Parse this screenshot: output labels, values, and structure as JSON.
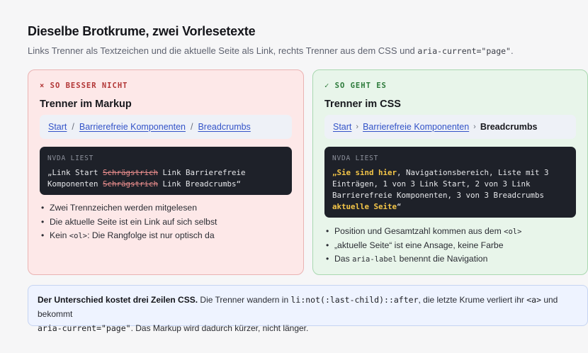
{
  "header": {
    "title": "Dieselbe Brotkrume, zwei Vorlesetexte",
    "subtitle_text": "Links Trenner als Textzeichen und die aktuelle Seite als Link, rechts Trenner aus dem CSS und",
    "subtitle_code": "aria-current=\"page\"",
    "subtitle_end": "."
  },
  "bad": {
    "tag": "× SO BESSER NICHT",
    "heading": "Trenner im Markup",
    "crumbs": {
      "item1": "Start",
      "sep": "/",
      "item2": "Barrierefreie Komponenten",
      "item3": "Breadcrumbs"
    },
    "reader": {
      "label": "NVDA LIEST",
      "part1": "„Link Start ",
      "strike1": "Schrägstrich",
      "part2": " Link Barrierefreie Komponenten ",
      "strike2": "Schrägstrich",
      "part3": " Link Breadcrumbs“"
    },
    "points": [
      {
        "text": "Zwei Trennzeichen werden mitgelesen"
      },
      {
        "text": "Die aktuelle Seite ist ein Link auf sich selbst"
      },
      {
        "pre": "Kein ",
        "code": "<ol>",
        "post": ": Die Rangfolge ist nur optisch da"
      }
    ]
  },
  "good": {
    "tag": "✓ SO GEHT ES",
    "heading": "Trenner im CSS",
    "crumbs": {
      "item1": "Start",
      "sep": "›",
      "item2": "Barrierefreie Komponenten",
      "item3": "Breadcrumbs"
    },
    "reader": {
      "label": "NVDA LIEST",
      "q_open": "„",
      "hl1": "Sie sind hier",
      "middle": ", Navigationsbereich, Liste mit 3 Einträgen, 1 von 3 Link Start, 2 von 3 Link Barrierefreie Komponenten, 3 von 3 Breadcrumbs ",
      "hl2": "aktuelle Seite",
      "q_close": "“"
    },
    "points": [
      {
        "pre": "Position und Gesamtzahl kommen aus dem ",
        "code": "<ol>",
        "post": ""
      },
      {
        "text": "„aktuelle Seite“ ist eine Ansage, keine Farbe"
      },
      {
        "pre": "Das ",
        "code": "aria-label",
        "post": " benennt die Navigation"
      }
    ]
  },
  "note": {
    "bold": "Der Unterschied kostet drei Zeilen CSS.",
    "t1": " Die Trenner wandern in ",
    "c1": "li:not(:last-child)::after",
    "t2": ", die letzte Krume verliert ihr ",
    "c2": "<a>",
    "t3": " und bekommt ",
    "c3": "aria-current=\"page\"",
    "t4": ". Das Markup wird dadurch kürzer, nicht länger."
  }
}
